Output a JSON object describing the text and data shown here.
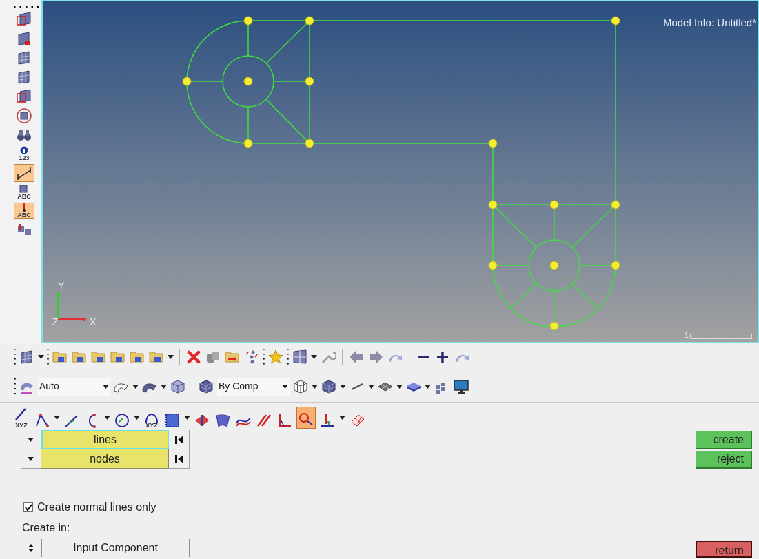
{
  "left_toolbar": {
    "items": [
      {
        "selected": false
      },
      {
        "selected": false
      },
      {
        "selected": false
      },
      {
        "selected": false
      },
      {
        "selected": false
      },
      {
        "selected": false
      },
      {
        "selected": false
      },
      {
        "selected": false,
        "label": "123"
      },
      {
        "selected": true
      },
      {
        "selected": false,
        "label": "ABC"
      },
      {
        "selected": true,
        "label": "ABC"
      },
      {
        "selected": false
      }
    ]
  },
  "viewport": {
    "model_info": "Model Info: Untitled*",
    "axis_labels": {
      "y": "Y",
      "z": "Z",
      "x": "X"
    },
    "scale_label": "1"
  },
  "display_toolbar": {
    "dropdowns": [
      {
        "value": "Auto"
      },
      {
        "value": "By Comp"
      }
    ]
  },
  "geometry_toolbar": {
    "items": [
      {
        "selected": false,
        "label": "XYZ"
      },
      {
        "selected": false
      },
      {
        "selected": false
      },
      {
        "selected": false
      },
      {
        "selected": false
      },
      {
        "selected": false,
        "label": "XYZ"
      },
      {
        "selected": false
      },
      {
        "selected": false
      },
      {
        "selected": false
      },
      {
        "selected": false
      },
      {
        "selected": false
      },
      {
        "selected": false
      },
      {
        "selected": true
      },
      {
        "selected": false
      },
      {
        "selected": false
      }
    ]
  },
  "panel": {
    "selectors": [
      {
        "value": "lines",
        "selected": true
      },
      {
        "value": "nodes",
        "selected": false
      }
    ],
    "checkbox": {
      "label": "Create normal lines only",
      "checked": true
    },
    "create_in_label": "Create in:",
    "create_in": {
      "value": "Input Component"
    },
    "buttons": [
      {
        "label": "create",
        "kind": "action"
      },
      {
        "label": "reject",
        "kind": "action"
      },
      {
        "label": "return",
        "kind": "exit"
      }
    ]
  }
}
